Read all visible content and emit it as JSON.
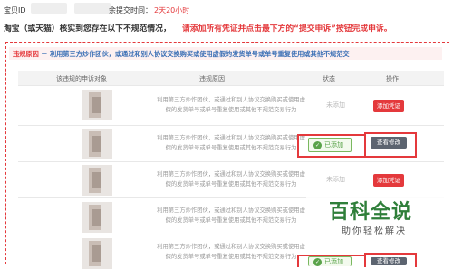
{
  "top": {
    "store_id_label": "宝贝ID",
    "deadline_label": "余提交时间：",
    "deadline_value": "2天20小时"
  },
  "notice": {
    "part1": "淘宝（或天猫）核实到您存在以下不规范情况，",
    "part2": "请添加所有凭证并点击最下方的“提交申诉”按钮完成申诉。"
  },
  "banner": {
    "label": "违规原因",
    "text": " － 利用第三方炒作团伙，或通过和别人协议交换购买或使用虚假的发货单号或单号重复使用或其他不规范交"
  },
  "table": {
    "headers": [
      "该违规的申诉对象",
      "违规原因",
      "状态",
      "操作"
    ],
    "rows": [
      {
        "reason_line1": "利用第三方炒作团伙，或通过和别人协议交换购买或使用虚",
        "reason_line2": "假的发货单号或单号重复使用或其他不规范交易行为",
        "status": "未添加",
        "action": "添加凭证",
        "state": "pending"
      },
      {
        "reason_line1": "利用第三方炒作团伙，或通过和别人协议交换购买或使用虚",
        "reason_line2": "假的发货单号或单号重复使用或其他不规范交易行为",
        "status": "已添加",
        "action": "查看修改",
        "state": "added"
      },
      {
        "reason_line1": "利用第三方炒作团伙，或通过和别人协议交换购买或使用虚",
        "reason_line2": "假的发货单号或单号重复使用或其他不规范交易行为",
        "status": "未添加",
        "action": "添加凭证",
        "state": "pending"
      },
      {
        "reason_line1": "利用第三方炒作团伙，或通过和别人协议交换购买或使用虚",
        "reason_line2": "假的发货单号或单号重复使用或其他不规范交易行为",
        "status": "已添加",
        "action": "查看修改",
        "state": "added"
      }
    ]
  },
  "watermark": {
    "title": "百科全说",
    "subtitle": "助你轻松解决"
  },
  "colors": {
    "accent_red": "#e4393c",
    "success_green": "#5aa34a",
    "link_blue": "#3a6fb5"
  }
}
